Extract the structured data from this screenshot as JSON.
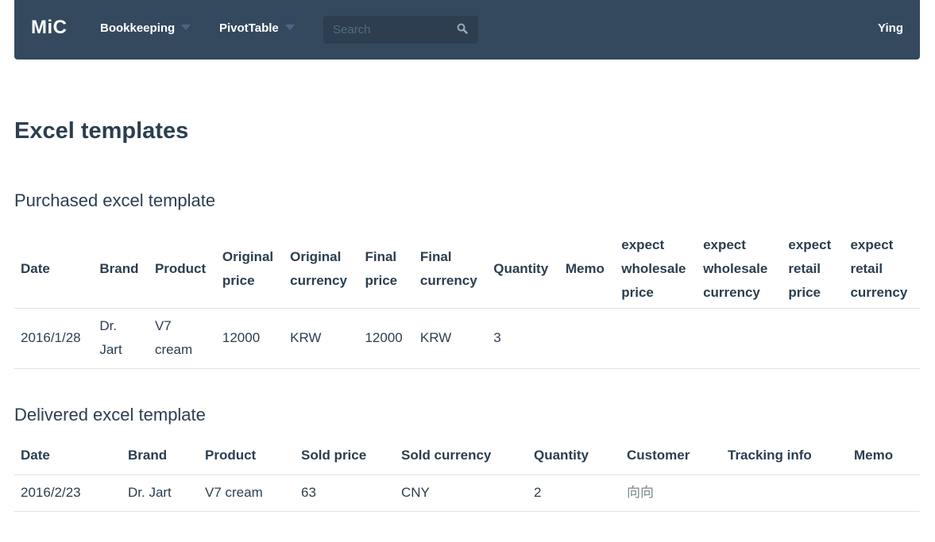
{
  "navbar": {
    "brand": "MiC",
    "menu": [
      {
        "label": "Bookkeeping"
      },
      {
        "label": "PivotTable"
      }
    ],
    "search": {
      "placeholder": "Search",
      "value": ""
    },
    "user": "Ying"
  },
  "page": {
    "title": "Excel templates"
  },
  "purchased": {
    "heading": "Purchased excel template",
    "columns": [
      "Date",
      "Brand",
      "Product",
      "Original price",
      "Original currency",
      "Final price",
      "Final currency",
      "Quantity",
      "Memo",
      "expect wholesale price",
      "expect wholesale currency",
      "expect retail price",
      "expect retail currency"
    ],
    "rows": [
      [
        "2016/1/28",
        "Dr. Jart",
        "V7 cream",
        "12000",
        "KRW",
        "12000",
        "KRW",
        "3",
        "",
        "",
        "",
        "",
        ""
      ]
    ]
  },
  "delivered": {
    "heading": "Delivered excel template",
    "columns": [
      "Date",
      "Brand",
      "Product",
      "Sold price",
      "Sold currency",
      "Quantity",
      "Customer",
      "Tracking info",
      "Memo"
    ],
    "rows": [
      [
        "2016/2/23",
        "Dr. Jart",
        "V7 cream",
        "63",
        "CNY",
        "2",
        "向向",
        "",
        ""
      ]
    ]
  },
  "icons": {
    "search": "search-icon",
    "caret": "caret-down-icon"
  },
  "colors": {
    "navbar": "#34495e",
    "search_bg": "#2c3e50",
    "text": "#2c3e50",
    "divider": "#dde3e8"
  }
}
